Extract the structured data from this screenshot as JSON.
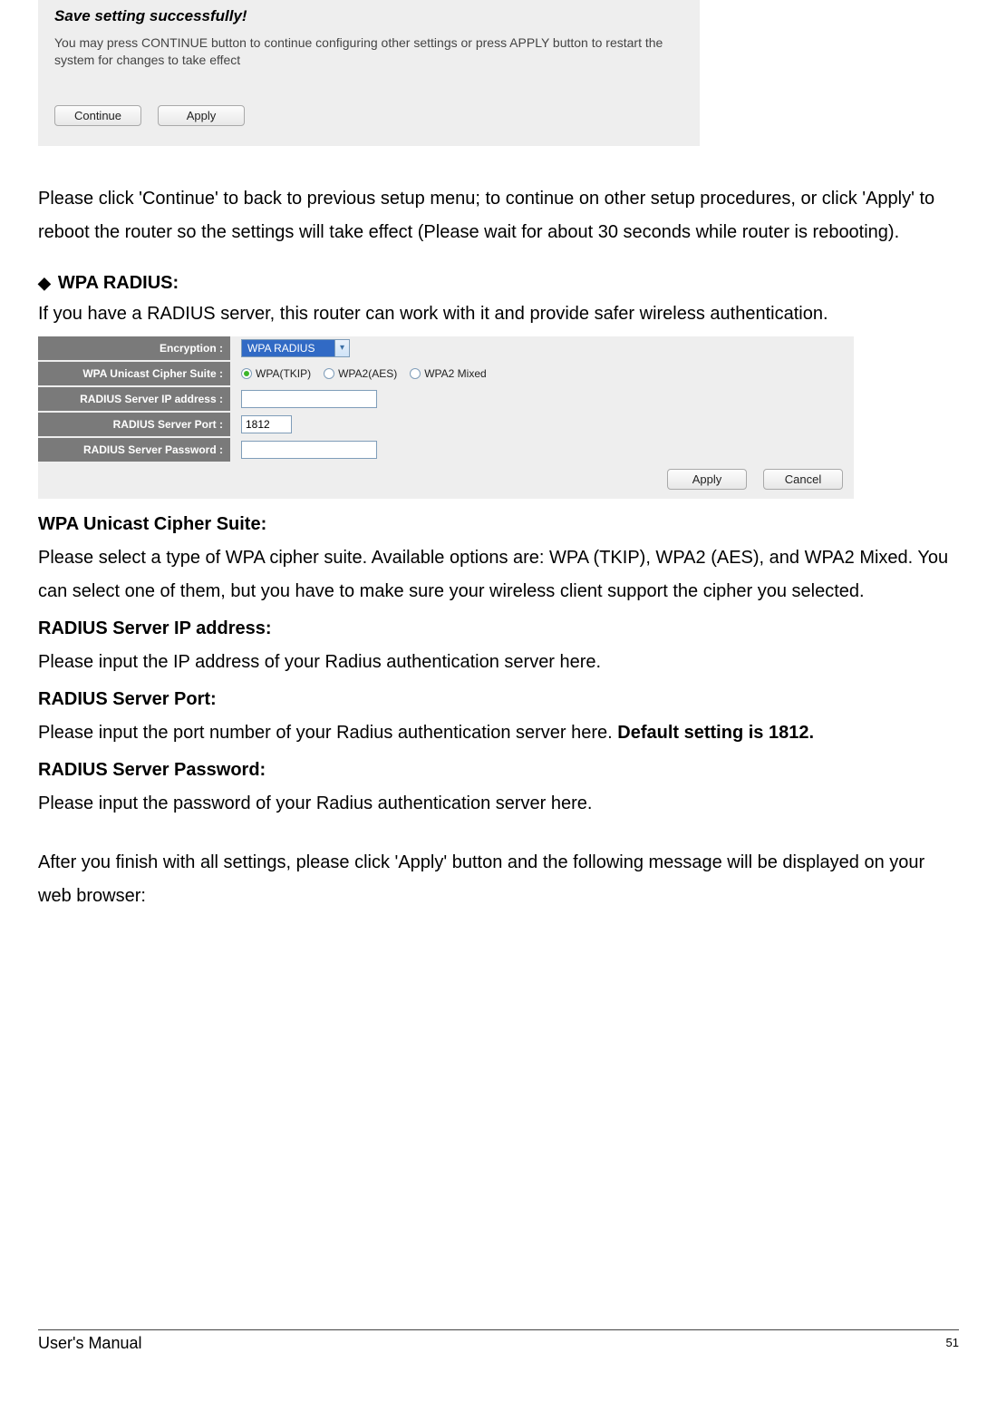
{
  "saveBox": {
    "title": "Save setting successfully!",
    "text": "You may press CONTINUE button to continue configuring other settings or press APPLY button to restart the system for changes to take effect",
    "continueBtn": "Continue",
    "applyBtn": "Apply"
  },
  "paras": {
    "p1": "Please click 'Continue' to back to previous setup menu; to continue on other setup procedures, or click 'Apply' to reboot the router so the settings will take effect (Please wait for about 30 seconds while router is rebooting).",
    "bulletHead": "WPA RADIUS:",
    "p2": "If you have a RADIUS server, this router can work with it and provide safer wireless authentication."
  },
  "cfg": {
    "labels": {
      "encryption": "Encryption :",
      "cipher": "WPA Unicast Cipher Suite :",
      "ip": "RADIUS Server IP address :",
      "port": "RADIUS Server Port :",
      "pw": "RADIUS Server Password :"
    },
    "encryptionValue": "WPA RADIUS",
    "cipherOpts": {
      "tkip": "WPA(TKIP)",
      "aes": "WPA2(AES)",
      "mixed": "WPA2 Mixed"
    },
    "portValue": "1812",
    "ipValue": "",
    "pwValue": "",
    "applyBtn": "Apply",
    "cancelBtn": "Cancel"
  },
  "defs": {
    "h1": "WPA Unicast Cipher Suite:",
    "b1": "Please select a type of WPA cipher suite. Available options are: WPA (TKIP), WPA2 (AES), and WPA2 Mixed. You can select one of them, but you have to make sure your wireless client support the cipher you selected.",
    "h2": "RADIUS Server IP address:",
    "b2": "Please input the IP address of your Radius authentication server here.",
    "h3": "RADIUS Server Port:",
    "b3a": "Please input the port number of your Radius authentication server here. ",
    "b3b": "Default setting is 1812.",
    "h4": "RADIUS Server Password:",
    "b4": "Please input the password of your Radius authentication server here.",
    "p5": "After you finish with all settings, please click 'Apply' button and the following message will be displayed on your web browser:"
  },
  "footer": {
    "left": "User's Manual",
    "pageNum": "51"
  }
}
